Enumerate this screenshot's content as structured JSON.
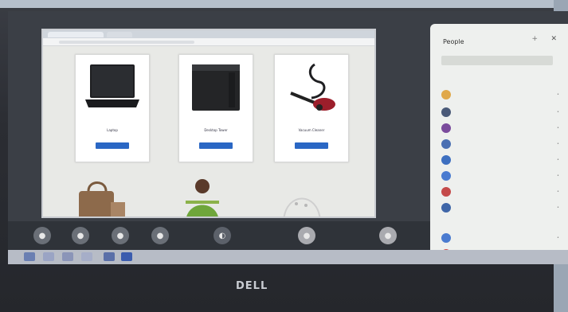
{
  "products_top": [
    {
      "name": "Laptop",
      "price": "",
      "button": ""
    },
    {
      "name": "Desktop Tower",
      "price": "",
      "button": ""
    },
    {
      "name": "Vacuum Cleaner",
      "price": "",
      "button": ""
    }
  ],
  "people_panel": {
    "title": "People",
    "search_placeholder": "",
    "section_in_call": "",
    "section_other": "",
    "participants": [
      "",
      "",
      "",
      "",
      "",
      "",
      "",
      "",
      "",
      ""
    ]
  },
  "monitor_brand": "DELL",
  "colors": {
    "button_blue": "#2a67c4",
    "panel_bg": "#eef0ee",
    "bezel": "#2b2d33"
  }
}
